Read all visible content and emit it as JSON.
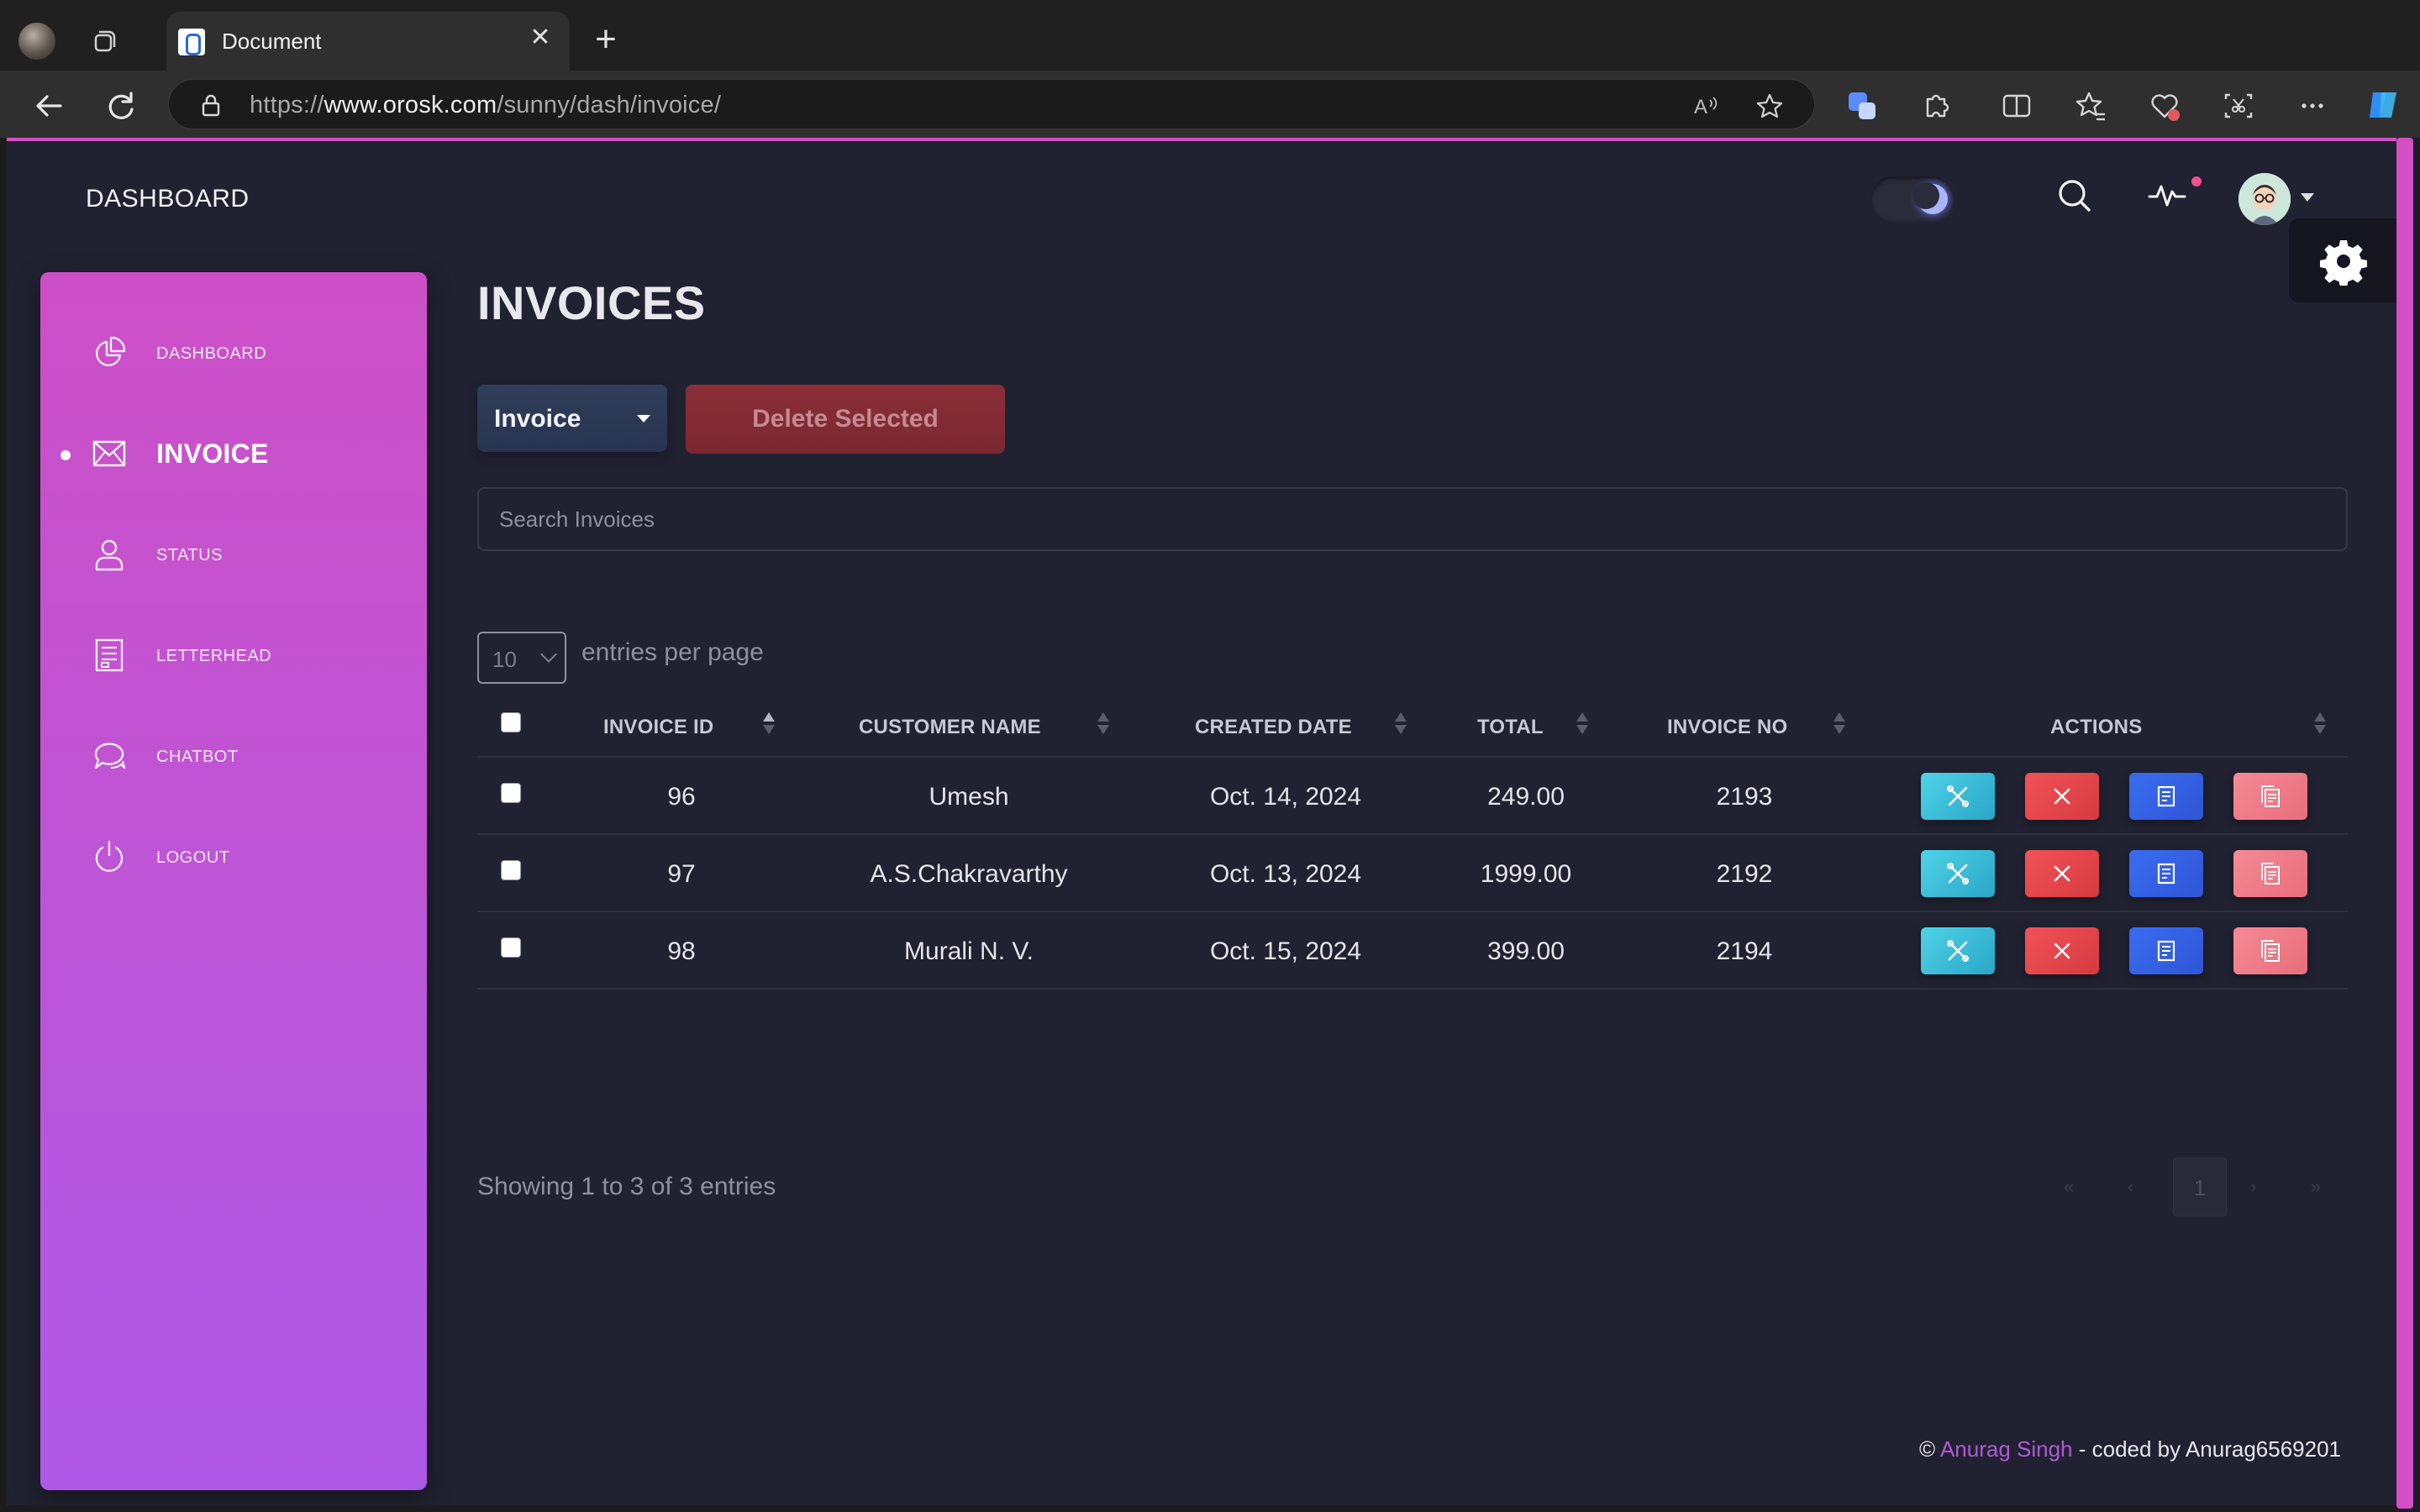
{
  "browser": {
    "tab_title": "Document",
    "url_scheme": "https://",
    "url_host": "www.orosk.com",
    "url_path": "/sunny/dash/invoice/"
  },
  "header": {
    "brand": "DASHBOARD",
    "theme": "dark"
  },
  "sidebar": {
    "items": [
      {
        "label": "DASHBOARD",
        "icon": "pie-chart-icon",
        "active": false
      },
      {
        "label": "INVOICE",
        "icon": "envelope-icon",
        "active": true
      },
      {
        "label": "STATUS",
        "icon": "user-icon",
        "active": false
      },
      {
        "label": "LETTERHEAD",
        "icon": "document-icon",
        "active": false
      },
      {
        "label": "CHATBOT",
        "icon": "chat-bubble-icon",
        "active": false
      },
      {
        "label": "LOGOUT",
        "icon": "power-icon",
        "active": false
      }
    ]
  },
  "main": {
    "title": "INVOICES",
    "dropdown_label": "Invoice",
    "delete_label": "Delete Selected",
    "search_placeholder": "Search Invoices",
    "per_page_value": "10",
    "per_page_text": "entries per page",
    "columns": [
      "INVOICE ID",
      "CUSTOMER NAME",
      "CREATED DATE",
      "TOTAL",
      "INVOICE NO",
      "ACTIONS"
    ],
    "rows": [
      {
        "id": "96",
        "customer": "Umesh",
        "date": "Oct. 14, 2024",
        "total": "249.00",
        "invoice_no": "2193"
      },
      {
        "id": "97",
        "customer": "A.S.Chakravarthy",
        "date": "Oct. 13, 2024",
        "total": "1999.00",
        "invoice_no": "2192"
      },
      {
        "id": "98",
        "customer": "Murali N. V.",
        "date": "Oct. 15, 2024",
        "total": "399.00",
        "invoice_no": "2194"
      }
    ],
    "showing_text": "Showing 1 to 3 of 3 entries",
    "pagination": {
      "first": "«",
      "prev": "‹",
      "current": "1",
      "next": "›",
      "last": "»"
    }
  },
  "footer": {
    "copyright": "©",
    "author_link": "Anurag Singh",
    "suffix": " - coded by Anurag6569201"
  },
  "colors": {
    "accent": "#d24fc4",
    "sidebar_gradient": [
      "#cd4fc7",
      "#ad58e6"
    ],
    "background": "#212231",
    "edit": "#2aa6c9",
    "delete": "#d63a40",
    "view": "#2f56d6",
    "copy": "#e86e7b"
  }
}
